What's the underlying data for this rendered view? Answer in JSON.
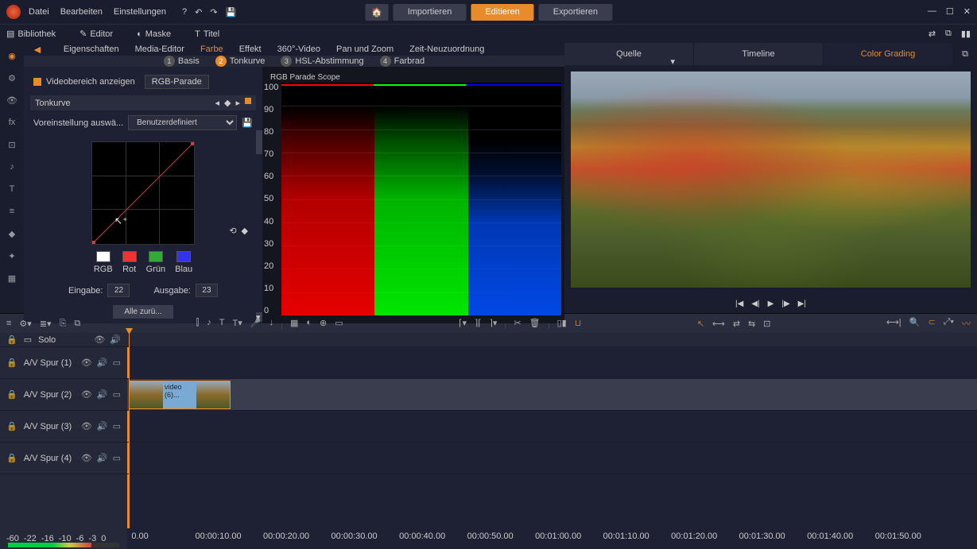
{
  "menu": {
    "file": "Datei",
    "edit": "Bearbeiten",
    "settings": "Einstellungen"
  },
  "topbtns": {
    "import": "Importieren",
    "edit": "Editieren",
    "export": "Exportieren"
  },
  "toolbar2": {
    "library": "Bibliothek",
    "editor": "Editor",
    "mask": "Maske",
    "title": "Titel"
  },
  "editor_tabs": {
    "properties": "Eigenschaften",
    "media": "Media-Editor",
    "color": "Farbe",
    "effect": "Effekt",
    "video360": "360°-Video",
    "panzoom": "Pan und Zoom",
    "timeremap": "Zeit-Neuzuordnung"
  },
  "subtabs": {
    "basic": "Basis",
    "tone": "Tonkurve",
    "hsl": "HSL-Abstimmung",
    "wheel": "Farbrad"
  },
  "curve": {
    "showrange": "Videobereich anzeigen",
    "rgbparade": "RGB-Parade",
    "section": "Tonkurve",
    "preset_label": "Voreinstellung auswä...",
    "preset_value": "Benutzerdefiniert",
    "swatches": {
      "rgb": "RGB",
      "rot": "Rot",
      "gruen": "Grün",
      "blau": "Blau"
    },
    "input_label": "Eingabe:",
    "input_val": "22",
    "output_label": "Ausgabe:",
    "output_val": "23",
    "reset": "Alle zurü..."
  },
  "scope": {
    "title": "RGB Parade Scope",
    "ticks": [
      "100",
      "90",
      "80",
      "70",
      "60",
      "50",
      "40",
      "30",
      "20",
      "10",
      "0"
    ]
  },
  "preview": {
    "source": "Quelle",
    "timeline": "Timeline",
    "colorgrading": "Color Grading"
  },
  "tracks": {
    "solo": "Solo",
    "items": [
      {
        "name": "A/V Spur (1)"
      },
      {
        "name": "A/V Spur (2)"
      },
      {
        "name": "A/V Spur (3)"
      },
      {
        "name": "A/V Spur (4)"
      }
    ],
    "clip_label": "video (6)..."
  },
  "ruler": {
    "head_labels": [
      "-60",
      "-22",
      "-16",
      "-10",
      "-6",
      "-3",
      "0"
    ],
    "ticks": [
      "0.00",
      "00:00:10.00",
      "00:00:20.00",
      "00:00:30.00",
      "00:00:40.00",
      "00:00:50.00",
      "00:01:00.00",
      "00:01:10.00",
      "00:01:20.00",
      "00:01:30.00",
      "00:01:40.00",
      "00:01:50.00"
    ]
  }
}
